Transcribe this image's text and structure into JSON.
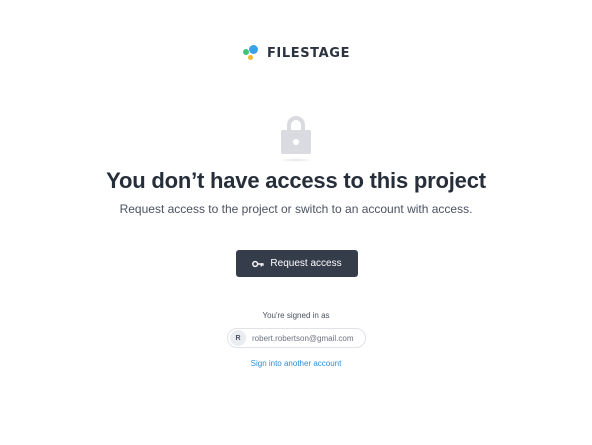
{
  "brand": {
    "name": "FILESTAGE",
    "colors": {
      "green": "#3ec47a",
      "blue": "#3aa3e8",
      "yellow": "#f5b82e"
    }
  },
  "main": {
    "icon": "lock-icon",
    "title": "You don’t have access to this project",
    "subtitle": "Request access to the project or switch to an account with access."
  },
  "actions": {
    "request_access": {
      "label": "Request access",
      "icon": "key-icon",
      "color": "#353d4b"
    }
  },
  "account": {
    "signed_in_label": "You're signed in as",
    "avatar_initial": "R",
    "email": "robert.robertson@gmail.com",
    "switch_link": "Sign into another account",
    "link_color": "#2e8fd6"
  }
}
